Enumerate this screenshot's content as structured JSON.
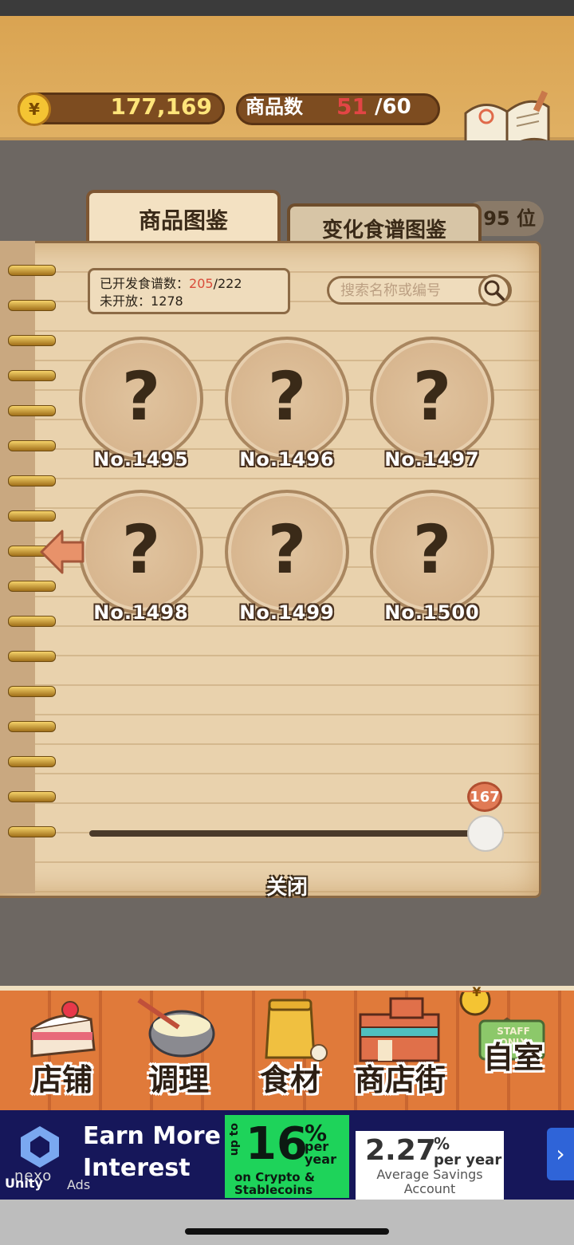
{
  "header": {
    "coins": "177,169",
    "coin_symbol": "¥",
    "item_count_label": "商品数",
    "item_count_current": "51",
    "item_count_total": "/60",
    "recipe_button_label": "食谱"
  },
  "tabs": {
    "items": "商品图鉴",
    "variant_recipes": "变化食谱图鉴",
    "rank": "95 位"
  },
  "stats": {
    "opened_label": "已开发食谱数：",
    "opened_value": "205",
    "opened_total": "/222",
    "unopened_label": "未开放：",
    "unopened_value": "1278"
  },
  "search": {
    "placeholder": "搜索名称或编号"
  },
  "grid": {
    "mark": "?",
    "slots": [
      "No.1495",
      "No.1496",
      "No.1497",
      "No.1498",
      "No.1499",
      "No.1500"
    ]
  },
  "slider": {
    "value": "167"
  },
  "close_label": "关闭",
  "bottom_nav": {
    "shop": "店铺",
    "cooking": "调理",
    "ingredients": "食材",
    "street": "商店街",
    "room": "自室",
    "staff_sign": "STAFF ONLY"
  },
  "ad": {
    "brand": "nexo",
    "headline": "Earn More Interest",
    "offer1_upto": "up to",
    "offer1_value": "16",
    "offer1_symbol": "%",
    "offer1_per": "per year",
    "offer1_sub": "on Crypto & Stablecoins",
    "offer2_value": "2.27",
    "offer2_symbol": "%",
    "offer2_per": "per year",
    "offer2_sub": "Average Savings Account",
    "next_glyph": "›",
    "unity": "Unity",
    "ads": "Ads"
  }
}
